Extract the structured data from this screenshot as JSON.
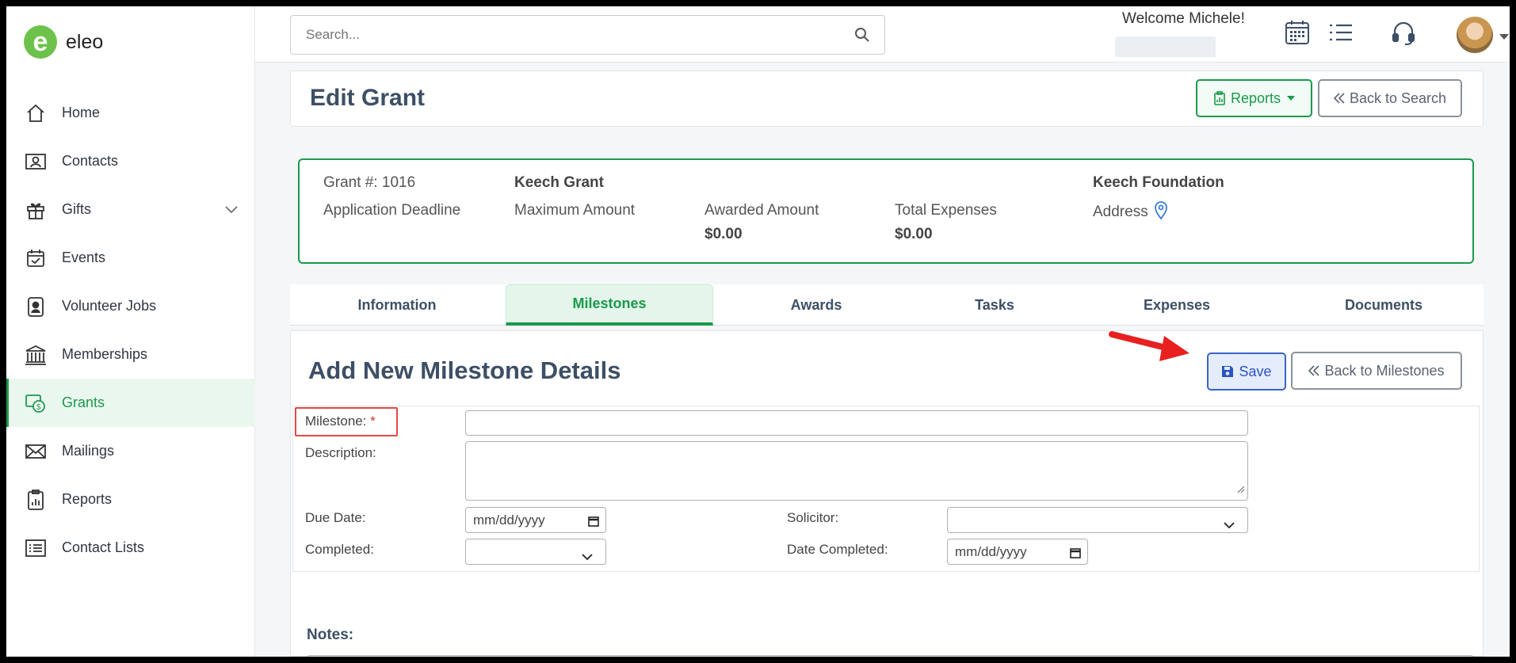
{
  "app": {
    "logo_letter": "e",
    "logo_text": "eleo",
    "brand_color": "#1a9a4a"
  },
  "sidebar": {
    "items": [
      {
        "label": "Home",
        "icon": "home-icon"
      },
      {
        "label": "Contacts",
        "icon": "contact-card-icon"
      },
      {
        "label": "Gifts",
        "icon": "gift-icon"
      },
      {
        "label": "Events",
        "icon": "calendar-check-icon"
      },
      {
        "label": "Volunteer Jobs",
        "icon": "badge-icon"
      },
      {
        "label": "Memberships",
        "icon": "building-icon"
      },
      {
        "label": "Grants",
        "icon": "grant-money-icon",
        "active": true
      },
      {
        "label": "Mailings",
        "icon": "envelope-icon"
      },
      {
        "label": "Reports",
        "icon": "report-clipboard-icon"
      },
      {
        "label": "Contact Lists",
        "icon": "list-icon"
      }
    ]
  },
  "topbar": {
    "search_placeholder": "Search...",
    "welcome": "Welcome Michele!"
  },
  "header": {
    "title": "Edit Grant",
    "reports_label": "Reports",
    "back_label": "Back to Search"
  },
  "summary": {
    "grant_number": "Grant #: 1016",
    "grant_name": "Keech Grant",
    "foundation": "Keech Foundation",
    "application_deadline_label": "Application Deadline",
    "maximum_amount_label": "Maximum Amount",
    "awarded_amount_label": "Awarded Amount",
    "awarded_amount_value": "$0.00",
    "total_expenses_label": "Total Expenses",
    "total_expenses_value": "$0.00",
    "address_label": "Address"
  },
  "tabs": [
    "Information",
    "Milestones",
    "Awards",
    "Tasks",
    "Expenses",
    "Documents"
  ],
  "active_tab": "Milestones",
  "form": {
    "title": "Add New Milestone Details",
    "save_label": "Save",
    "back_label": "Back to Milestones",
    "milestone_label": "Milestone:",
    "required_mark": "*",
    "description_label": "Description:",
    "due_date_label": "Due Date:",
    "due_date_placeholder": "mm/dd/yyyy",
    "solicitor_label": "Solicitor:",
    "completed_label": "Completed:",
    "date_completed_label": "Date Completed:",
    "date_completed_placeholder": "mm/dd/yyyy",
    "notes_label": "Notes:"
  }
}
